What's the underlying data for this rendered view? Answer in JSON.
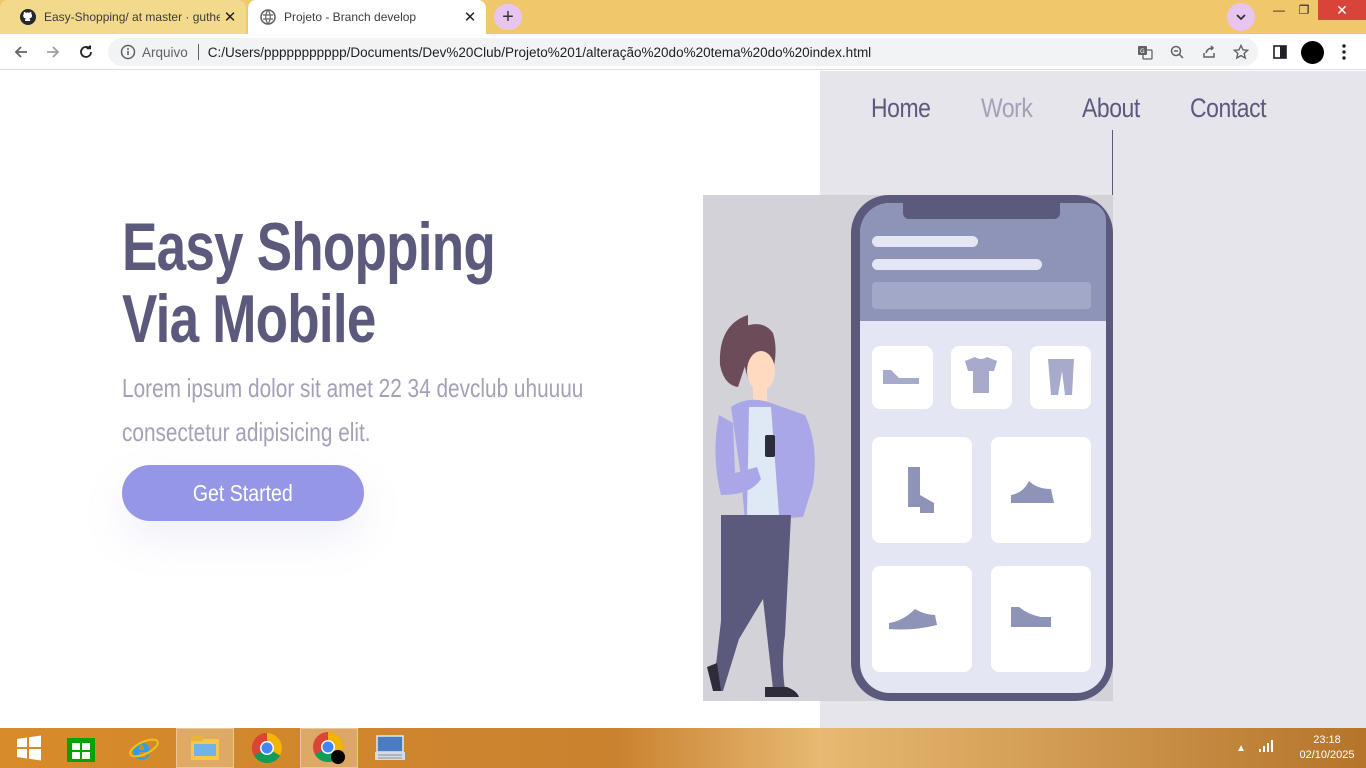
{
  "browser": {
    "tabs": [
      {
        "title": "Easy-Shopping/ at master · guthe",
        "icon": "github-icon"
      },
      {
        "title": "Projeto - Branch develop",
        "icon": "globe-icon"
      }
    ],
    "address": {
      "security_label": "Arquivo",
      "url": "C:/Users/ppppppppppp/Documents/Dev%20Club/Projeto%201/alteração%20do%20tema%20do%20index.html"
    }
  },
  "page": {
    "nav": {
      "home": "Home",
      "work": "Work",
      "about": "About",
      "contact": "Contact",
      "active": "Work"
    },
    "hero": {
      "title_line1": "Easy Shopping",
      "title_line2": "Via Mobile",
      "text": "Lorem ipsum dolor sit amet 22 34 devclub uhuuuu consectetur adipisicing elit.",
      "cta": "Get Started"
    },
    "colors": {
      "primary": "#5c5a7c",
      "muted": "#a3a1b6",
      "accent": "#9597e6",
      "panel": "#e6e5ec"
    }
  },
  "taskbar": {
    "apps": [
      "windows-start-icon",
      "store-icon",
      "internet-explorer-icon",
      "file-explorer-icon",
      "chrome-icon",
      "chrome-profile-icon",
      "keyboard-app-icon"
    ],
    "time": "23:18",
    "date": "02/10/2025"
  }
}
